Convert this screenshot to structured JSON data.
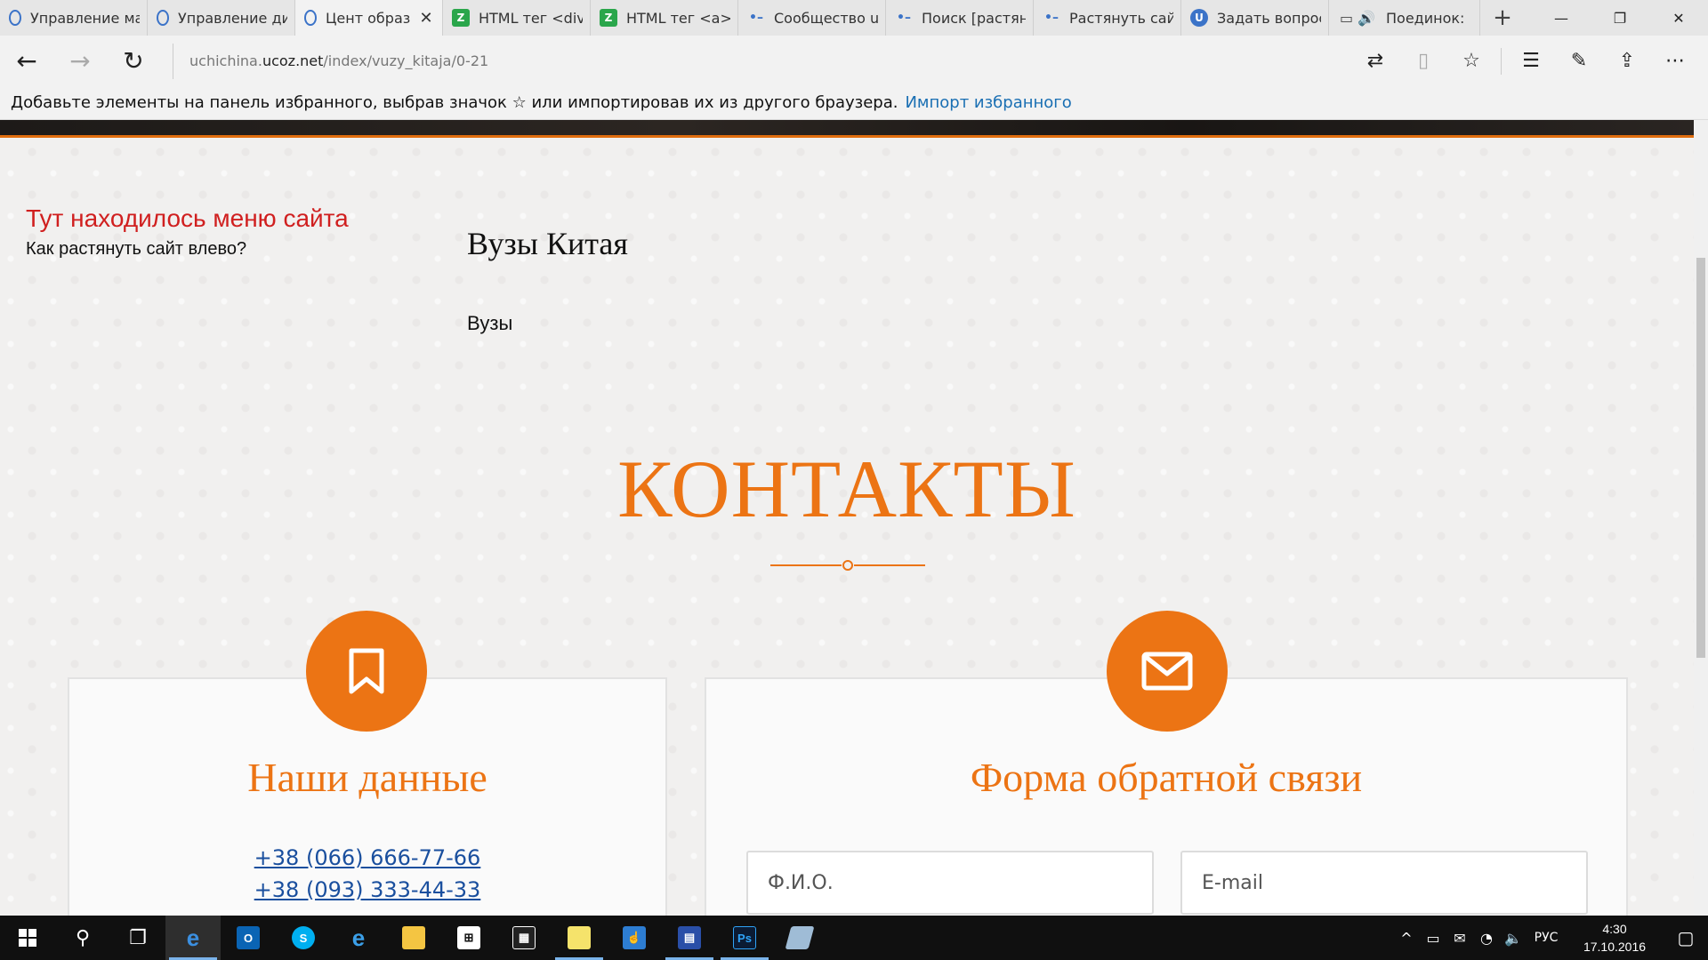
{
  "browser": {
    "tabs": [
      {
        "title": "Управление ма",
        "icon": "ucoz-icon",
        "active": false
      },
      {
        "title": "Управление ди:",
        "icon": "ucoz-icon",
        "active": false
      },
      {
        "title": "Цент образ",
        "icon": "ucoz-icon",
        "active": true,
        "close": "✕"
      },
      {
        "title": "HTML тег <div>",
        "icon": "z-icon",
        "active": false
      },
      {
        "title": "HTML тег <a>.",
        "icon": "z-icon",
        "active": false
      },
      {
        "title": "Сообщество uC",
        "icon": "dots-icon",
        "active": false
      },
      {
        "title": "Поиск [растяну",
        "icon": "dots-icon",
        "active": false
      },
      {
        "title": "Растянуть сайт",
        "icon": "dots-icon",
        "active": false
      },
      {
        "title": "Задать вопрос",
        "icon": "u-icon",
        "active": false
      },
      {
        "title": "Поединок:",
        "icon": "window-audio-icon",
        "active": false
      }
    ],
    "new_tab": "+",
    "url_prefix": "uchichina.",
    "url_domain": "ucoz.net",
    "url_path": "/index/vuzy_kitaja/0-21",
    "favorites_prompt": "Добавьте элементы на панель избранного, выбрав значок ☆ или импортировав их из другого браузера.",
    "favorites_link": "Импорт избранного"
  },
  "page": {
    "menu_note": "Тут находилось меню сайта",
    "menu_question": "Как растянуть сайт влево?",
    "content_title": "Вузы Китая",
    "content_text": "Вузы",
    "contacts_title": "КОНТАКТЫ",
    "our_data_title": "Наши данные",
    "phones": [
      "+38 (066) 666-77-66",
      "+38 (093) 333-44-33"
    ],
    "feedback_title": "Форма обратной связи",
    "name_placeholder": "Ф.И.О.",
    "email_placeholder": "E-mail"
  },
  "taskbar": {
    "apps": [
      "start-icon",
      "search-icon",
      "task-view-icon",
      "edge-icon",
      "outlook-icon",
      "skype-icon",
      "ie-icon",
      "file-explorer-icon",
      "store-icon",
      "calculator-icon",
      "sticky-notes-icon",
      "touch-app-icon",
      "save-app-icon",
      "photoshop-icon",
      "pen-app-icon"
    ],
    "language": "РУС",
    "time": "4:30",
    "date": "17.10.2016"
  },
  "colors": {
    "accent": "#ec7414",
    "menu_note": "#d01f1f",
    "link": "#1a4f9e"
  }
}
